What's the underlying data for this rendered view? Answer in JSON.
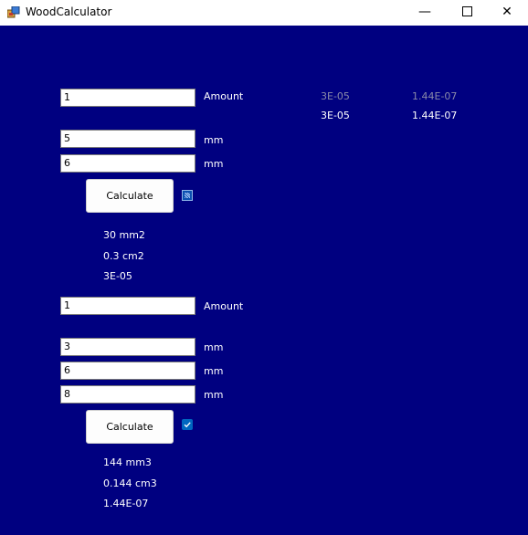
{
  "window": {
    "title": "WoodCalculator"
  },
  "area_section": {
    "amount_value": "1",
    "amount_label": "Amount",
    "dim1_value": "5",
    "dim1_unit": "mm",
    "dim2_value": "6",
    "dim2_unit": "mm",
    "calculate_label": "Calculate",
    "checkbox_checked": true,
    "result_mm": "30 mm2",
    "result_cm": "0.3 cm2",
    "result_m": "3E-05"
  },
  "volume_section": {
    "amount_value": "1",
    "amount_label": "Amount",
    "dim1_value": "3",
    "dim1_unit": "mm",
    "dim2_value": "6",
    "dim2_unit": "mm",
    "dim3_value": "8",
    "dim3_unit": "mm",
    "calculate_label": "Calculate",
    "checkbox_checked": true,
    "result_mm": "144 mm3",
    "result_cm": "0.144 cm3",
    "result_m": "1.44E-07"
  },
  "summary": {
    "row1_area": "3E-05",
    "row1_volume": "1.44E-07",
    "row2_area": "3E-05",
    "row2_volume": "1.44E-07"
  },
  "icons": {
    "app": "app-icon",
    "minimize": "minimize-icon",
    "maximize": "maximize-icon",
    "close": "close-icon",
    "check": "checkmark-icon"
  },
  "colors": {
    "background": "#000080",
    "titlebar": "#ffffff",
    "checkbox_accent": "#0067c0"
  }
}
